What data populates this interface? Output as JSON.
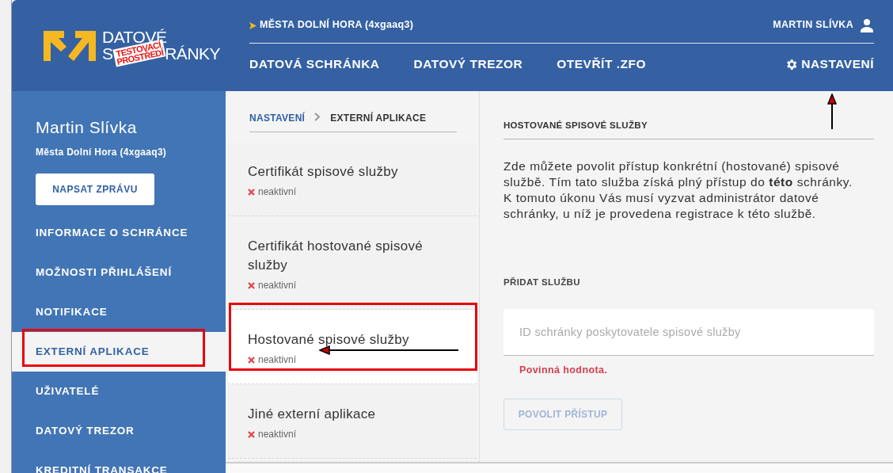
{
  "logo": {
    "line_1": "DATOVÉ",
    "line_2_start": "S",
    "line_2_end": "RÁNKY",
    "stamp_1": "TESTOVACÍ",
    "stamp_2": "PROSTŘEDÍ"
  },
  "header": {
    "mailbox": "MĚSTA DOLNÍ HORA (4xgaaq3)",
    "user": "MARTIN SLÍVKA",
    "nav": [
      {
        "label": "DATOVÁ SCHRÁNKA",
        "kind": "link"
      },
      {
        "label": "DATOVÝ TREZOR",
        "kind": "link"
      },
      {
        "label": "OTEVŘÍT .ZFO",
        "kind": "link"
      },
      {
        "label": "NASTAVENÍ",
        "kind": "settings"
      }
    ]
  },
  "sidebar": {
    "name": "Martin Slívka",
    "mailbox": "Města Dolní Hora (4xgaaq3)",
    "button": "NAPSAT ZPRÁVU",
    "items": [
      {
        "label": "INFORMACE O SCHRÁNCE",
        "selected": false
      },
      {
        "label": "MOŽNOSTI PŘIHLÁŠENÍ",
        "selected": false
      },
      {
        "label": "NOTIFIKACE",
        "selected": false
      },
      {
        "label": "EXTERNÍ APLIKACE",
        "selected": true
      },
      {
        "label": "UŽIVATELÉ",
        "selected": false
      },
      {
        "label": "DATOVÝ TREZOR",
        "selected": false
      },
      {
        "label": "KREDITNÍ TRANSAKCE",
        "selected": false
      }
    ]
  },
  "breadcrumb": [
    {
      "label": "NASTAVENÍ",
      "kind": "link"
    },
    {
      "label": "EXTERNÍ APLIKACE",
      "kind": "current"
    }
  ],
  "apps": [
    {
      "title": "Certifikát spisové služby",
      "status": "neaktivní",
      "active": false,
      "selected": false
    },
    {
      "title": "Certifikát hostované spisové služby",
      "status": "neaktivní",
      "active": false,
      "selected": false
    },
    {
      "title": "Hostované spisové služby",
      "status": "neaktivní",
      "active": false,
      "selected": true
    },
    {
      "title": "Jiné externí aplikace",
      "status": "neaktivní",
      "active": false,
      "selected": false
    }
  ],
  "detail": {
    "heading": "HOSTOVANÉ SPISOVÉ SLUŽBY",
    "text": "Zde můžete povolit přístup konkrétní (hostované) spisové službě. Tím tato služba získá plný přístup do **této** schránky. K tomuto úkonu Vás musí vyzvat administrátor datové schránky, u níž je provedena registrace k této službě.",
    "section": "PŘIDAT SLUŽBU",
    "field": {
      "placeholder": "ID schránky poskytovatele spisové služby"
    },
    "error": "Povinná hodnota.",
    "button": {
      "label": "POVOLIT PŘÍSTUP",
      "disabled": true
    }
  }
}
